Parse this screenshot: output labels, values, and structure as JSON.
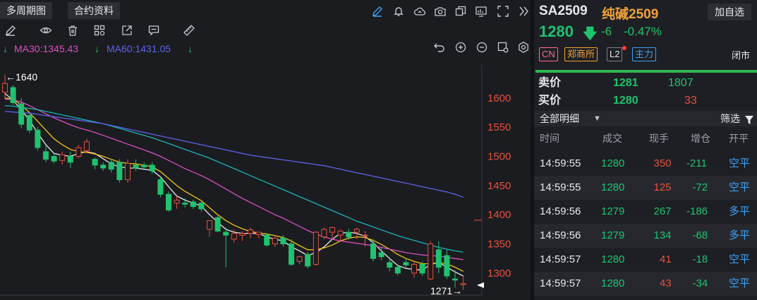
{
  "toolbar": {
    "multi_period_label": "多周期图",
    "contract_info_label": "合约资料"
  },
  "ma": {
    "ma30_label": "MA30:1345.43",
    "ma60_label": "MA60:1431.05",
    "ma30_color": "#d84fbf",
    "ma60_color": "#5b63e6"
  },
  "axis": {
    "ticks": [
      "1600",
      "1550",
      "1500",
      "1450",
      "1400",
      "1350",
      "1300"
    ],
    "high_label": "←1640",
    "low_label": "1271→",
    "color": "#e5513f"
  },
  "chart_data": {
    "type": "candlestick",
    "ylim": [
      1272,
      1647
    ],
    "grid": false,
    "annotations": [
      "←1640",
      "1271→"
    ],
    "candles": [
      {
        "o": 1610,
        "h": 1640,
        "l": 1598,
        "c": 1625
      },
      {
        "o": 1618,
        "h": 1622,
        "l": 1588,
        "c": 1592
      },
      {
        "o": 1590,
        "h": 1600,
        "l": 1548,
        "c": 1555
      },
      {
        "o": 1570,
        "h": 1572,
        "l": 1540,
        "c": 1545
      },
      {
        "o": 1545,
        "h": 1550,
        "l": 1510,
        "c": 1515
      },
      {
        "o": 1508,
        "h": 1518,
        "l": 1490,
        "c": 1495
      },
      {
        "o": 1500,
        "h": 1506,
        "l": 1488,
        "c": 1492
      },
      {
        "o": 1493,
        "h": 1508,
        "l": 1486,
        "c": 1503
      },
      {
        "o": 1500,
        "h": 1508,
        "l": 1480,
        "c": 1490
      },
      {
        "o": 1500,
        "h": 1520,
        "l": 1496,
        "c": 1515
      },
      {
        "o": 1510,
        "h": 1530,
        "l": 1505,
        "c": 1525
      },
      {
        "o": 1495,
        "h": 1498,
        "l": 1478,
        "c": 1485
      },
      {
        "o": 1485,
        "h": 1490,
        "l": 1475,
        "c": 1480
      },
      {
        "o": 1490,
        "h": 1495,
        "l": 1472,
        "c": 1478
      },
      {
        "o": 1490,
        "h": 1495,
        "l": 1455,
        "c": 1460
      },
      {
        "o": 1460,
        "h": 1495,
        "l": 1455,
        "c": 1488
      },
      {
        "o": 1485,
        "h": 1495,
        "l": 1475,
        "c": 1480
      },
      {
        "o": 1485,
        "h": 1490,
        "l": 1478,
        "c": 1482
      },
      {
        "o": 1485,
        "h": 1490,
        "l": 1470,
        "c": 1475
      },
      {
        "o": 1460,
        "h": 1465,
        "l": 1430,
        "c": 1435
      },
      {
        "o": 1435,
        "h": 1440,
        "l": 1405,
        "c": 1408
      },
      {
        "o": 1420,
        "h": 1432,
        "l": 1410,
        "c": 1425
      },
      {
        "o": 1420,
        "h": 1428,
        "l": 1412,
        "c": 1418
      },
      {
        "o": 1422,
        "h": 1426,
        "l": 1410,
        "c": 1414
      },
      {
        "o": 1420,
        "h": 1425,
        "l": 1405,
        "c": 1410
      },
      {
        "o": 1375,
        "h": 1385,
        "l": 1362,
        "c": 1390
      },
      {
        "o": 1395,
        "h": 1398,
        "l": 1370,
        "c": 1372
      },
      {
        "o": 1370,
        "h": 1378,
        "l": 1310,
        "c": 1365
      },
      {
        "o": 1358,
        "h": 1375,
        "l": 1352,
        "c": 1368
      },
      {
        "o": 1365,
        "h": 1372,
        "l": 1355,
        "c": 1368
      },
      {
        "o": 1368,
        "h": 1378,
        "l": 1360,
        "c": 1374
      },
      {
        "o": 1366,
        "h": 1370,
        "l": 1360,
        "c": 1370
      },
      {
        "o": 1365,
        "h": 1368,
        "l": 1345,
        "c": 1348
      },
      {
        "o": 1350,
        "h": 1362,
        "l": 1345,
        "c": 1360
      },
      {
        "o": 1360,
        "h": 1365,
        "l": 1345,
        "c": 1350
      },
      {
        "o": 1350,
        "h": 1358,
        "l": 1312,
        "c": 1315
      },
      {
        "o": 1320,
        "h": 1330,
        "l": 1315,
        "c": 1328
      },
      {
        "o": 1332,
        "h": 1336,
        "l": 1308,
        "c": 1312
      },
      {
        "o": 1315,
        "h": 1372,
        "l": 1312,
        "c": 1370
      },
      {
        "o": 1362,
        "h": 1378,
        "l": 1358,
        "c": 1375
      },
      {
        "o": 1370,
        "h": 1380,
        "l": 1360,
        "c": 1378
      },
      {
        "o": 1365,
        "h": 1374,
        "l": 1355,
        "c": 1372
      },
      {
        "o": 1370,
        "h": 1376,
        "l": 1357,
        "c": 1362
      },
      {
        "o": 1370,
        "h": 1378,
        "l": 1358,
        "c": 1375
      },
      {
        "o": 1365,
        "h": 1372,
        "l": 1345,
        "c": 1365
      },
      {
        "o": 1350,
        "h": 1358,
        "l": 1320,
        "c": 1325
      },
      {
        "o": 1335,
        "h": 1345,
        "l": 1322,
        "c": 1328
      },
      {
        "o": 1318,
        "h": 1325,
        "l": 1303,
        "c": 1310
      },
      {
        "o": 1310,
        "h": 1315,
        "l": 1296,
        "c": 1300
      },
      {
        "o": 1318,
        "h": 1325,
        "l": 1310,
        "c": 1314
      },
      {
        "o": 1300,
        "h": 1318,
        "l": 1292,
        "c": 1315
      },
      {
        "o": 1315,
        "h": 1320,
        "l": 1295,
        "c": 1300
      },
      {
        "o": 1290,
        "h": 1355,
        "l": 1288,
        "c": 1350
      },
      {
        "o": 1340,
        "h": 1355,
        "l": 1300,
        "c": 1310
      },
      {
        "o": 1330,
        "h": 1340,
        "l": 1290,
        "c": 1295
      },
      {
        "o": 1290,
        "h": 1305,
        "l": 1275,
        "c": 1288
      },
      {
        "o": 1280,
        "h": 1295,
        "l": 1271,
        "c": 1282
      }
    ],
    "ma_lines": [
      {
        "color": "#eaeaea",
        "points": [
          1608,
          1596,
          1580,
          1562,
          1540,
          1520,
          1505,
          1502,
          1500,
          1505,
          1508,
          1505,
          1496,
          1487,
          1482,
          1480,
          1480,
          1478,
          1476,
          1465,
          1448,
          1432,
          1425,
          1420,
          1415,
          1400,
          1387,
          1375,
          1370,
          1368,
          1368,
          1368,
          1362,
          1358,
          1355,
          1345,
          1338,
          1330,
          1335,
          1345,
          1358,
          1368,
          1370,
          1368,
          1363,
          1352,
          1338,
          1325,
          1313,
          1308,
          1306,
          1305,
          1315,
          1318,
          1310,
          1302,
          1295
        ]
      },
      {
        "color": "#f0c419",
        "points": [
          1600,
          1598,
          1588,
          1575,
          1560,
          1545,
          1530,
          1520,
          1512,
          1508,
          1507,
          1504,
          1500,
          1495,
          1490,
          1488,
          1487,
          1485,
          1482,
          1474,
          1462,
          1450,
          1440,
          1432,
          1424,
          1412,
          1400,
          1390,
          1382,
          1376,
          1371,
          1369,
          1367,
          1364,
          1361,
          1355,
          1347,
          1340,
          1340,
          1343,
          1348,
          1355,
          1360,
          1362,
          1361,
          1356,
          1349,
          1341,
          1332,
          1325,
          1320,
          1316,
          1316,
          1318,
          1316,
          1310,
          1303
        ]
      },
      {
        "color": "#d84fbf",
        "points": [
          1598,
          1597,
          1593,
          1587,
          1580,
          1573,
          1566,
          1560,
          1554,
          1549,
          1545,
          1541,
          1536,
          1531,
          1526,
          1521,
          1516,
          1511,
          1506,
          1500,
          1493,
          1486,
          1479,
          1473,
          1467,
          1460,
          1452,
          1444,
          1436,
          1428,
          1421,
          1414,
          1407,
          1400,
          1394,
          1387,
          1380,
          1373,
          1367,
          1362,
          1358,
          1355,
          1353,
          1351,
          1349,
          1347,
          1344,
          1341,
          1338,
          1335,
          1333,
          1331,
          1330,
          1329,
          1327,
          1325,
          1323
        ]
      },
      {
        "color": "#19b3b5",
        "points": [
          1587,
          1586,
          1584,
          1582,
          1580,
          1577,
          1574,
          1571,
          1568,
          1565,
          1562,
          1559,
          1556,
          1552,
          1548,
          1544,
          1540,
          1536,
          1532,
          1527,
          1522,
          1517,
          1512,
          1507,
          1502,
          1497,
          1491,
          1485,
          1479,
          1473,
          1467,
          1461,
          1455,
          1449,
          1443,
          1437,
          1431,
          1425,
          1419,
          1413,
          1407,
          1401,
          1395,
          1389,
          1384,
          1379,
          1374,
          1369,
          1364,
          1360,
          1356,
          1352,
          1348,
          1344,
          1341,
          1338,
          1336
        ]
      },
      {
        "color": "#5b63e6",
        "points": [
          1577,
          1576,
          1575,
          1574,
          1572,
          1570,
          1568,
          1566,
          1564,
          1562,
          1560,
          1558,
          1556,
          1553,
          1550,
          1547,
          1544,
          1541,
          1538,
          1535,
          1532,
          1529,
          1526,
          1523,
          1520,
          1517,
          1514,
          1511,
          1508,
          1505,
          1502,
          1500,
          1498,
          1496,
          1494,
          1492,
          1490,
          1488,
          1486,
          1484,
          1481,
          1478,
          1475,
          1472,
          1469,
          1466,
          1463,
          1460,
          1457,
          1454,
          1451,
          1448,
          1445,
          1442,
          1439,
          1435,
          1430
        ]
      }
    ]
  },
  "quote": {
    "code": "SA2509",
    "name": "纯碱2509",
    "add_watch_label": "加自选",
    "last_price": "1280",
    "change": "-6",
    "change_pct": "-0.47%",
    "badges": [
      "CN",
      "郑商所",
      "L2",
      "主力"
    ],
    "status": "闭市",
    "ask_label": "卖价",
    "ask_price": "1281",
    "ask_vol": "1807",
    "bid_label": "买价",
    "bid_price": "1280",
    "bid_vol": "33"
  },
  "ticks_panel": {
    "title": "全部明细",
    "filter_label": "筛选",
    "columns": [
      "时间",
      "成交",
      "现手",
      "增仓",
      "开平"
    ],
    "rows": [
      {
        "time": "14:59:55",
        "price": "1280",
        "vol": "350",
        "oi": "-211",
        "type": "空平",
        "vol_color": "#e5513f",
        "oi_color": "#1fc36f",
        "type_color": "#3fa0f0"
      },
      {
        "time": "14:59:55",
        "price": "1280",
        "vol": "125",
        "oi": "-72",
        "type": "空平",
        "vol_color": "#e5513f",
        "oi_color": "#1fc36f",
        "type_color": "#3fa0f0"
      },
      {
        "time": "14:59:56",
        "price": "1279",
        "vol": "267",
        "oi": "-186",
        "type": "多平",
        "vol_color": "#1fc36f",
        "oi_color": "#1fc36f",
        "type_color": "#3fa0f0"
      },
      {
        "time": "14:59:56",
        "price": "1279",
        "vol": "134",
        "oi": "-68",
        "type": "多平",
        "vol_color": "#1fc36f",
        "oi_color": "#1fc36f",
        "type_color": "#3fa0f0"
      },
      {
        "time": "14:59:57",
        "price": "1280",
        "vol": "41",
        "oi": "-18",
        "type": "空平",
        "vol_color": "#e5513f",
        "oi_color": "#1fc36f",
        "type_color": "#3fa0f0"
      },
      {
        "time": "14:59:57",
        "price": "1280",
        "vol": "43",
        "oi": "-34",
        "type": "空平",
        "vol_color": "#e5513f",
        "oi_color": "#1fc36f",
        "type_color": "#3fa0f0"
      }
    ]
  },
  "colors": {
    "up": "#e5513f",
    "down": "#1fc36f",
    "accent_gold": "#f0a23b"
  }
}
